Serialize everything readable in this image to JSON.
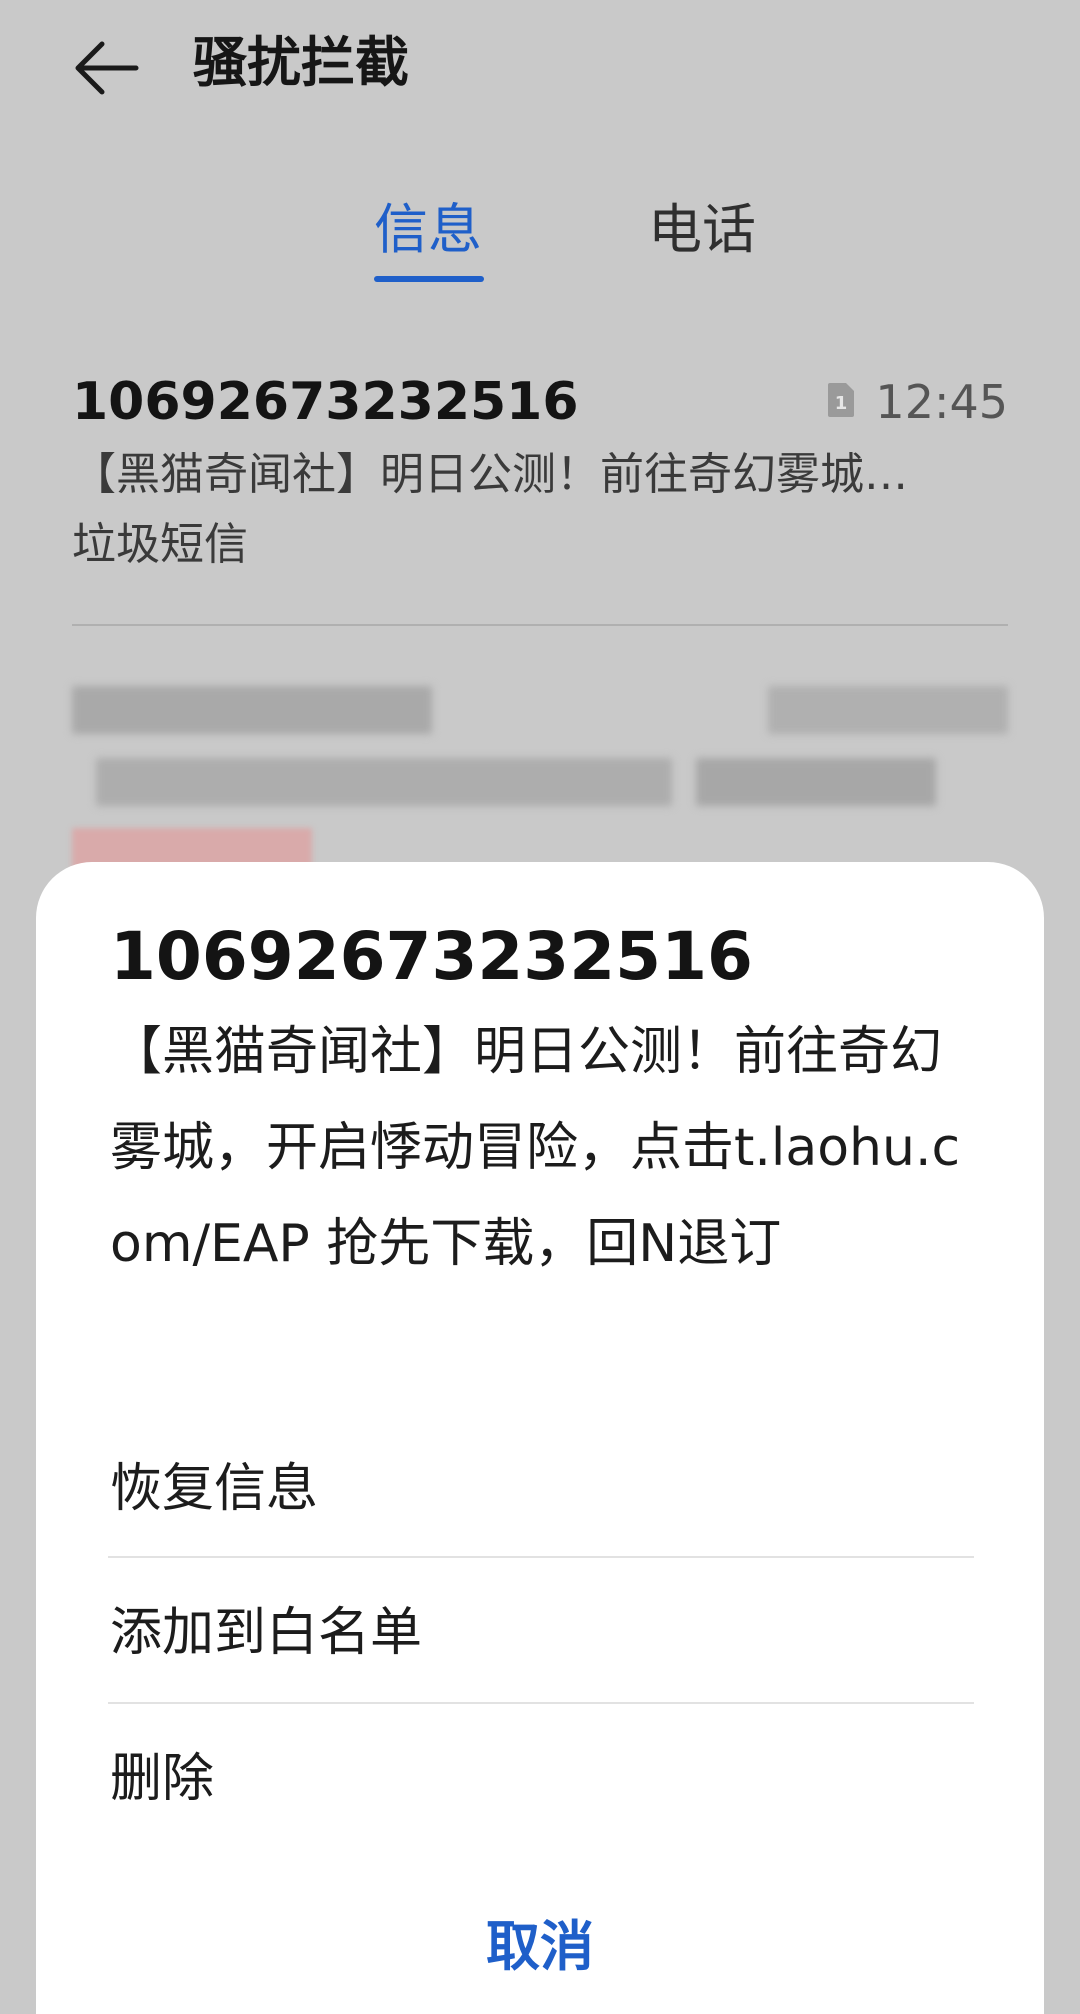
{
  "header": {
    "back_icon": "arrow-left-icon",
    "title": "骚扰拦截"
  },
  "tabs": [
    {
      "label": "信息",
      "active": true
    },
    {
      "label": "电话",
      "active": false
    }
  ],
  "colors": {
    "accent": "#1f5fc9",
    "overlay_bg": "#c9c9c9",
    "sheet_bg": "#ffffff"
  },
  "messages": [
    {
      "number": "10692673232516",
      "sim_icon": "sim-card-1-icon",
      "time": "12:45",
      "preview": "【黑猫奇闻社】明日公测！前往奇幻雾城…",
      "tag": "垃圾短信"
    }
  ],
  "sheet": {
    "number": "10692673232516",
    "body": "【黑猫奇闻社】明日公测！前往奇幻雾城，开启悸动冒险，点击t.laohu.com/EAP 抢先下载，回N退订",
    "options": {
      "restore": "恢复信息",
      "whitelist": "添加到白名单",
      "delete": "删除"
    },
    "cancel": "取消"
  }
}
